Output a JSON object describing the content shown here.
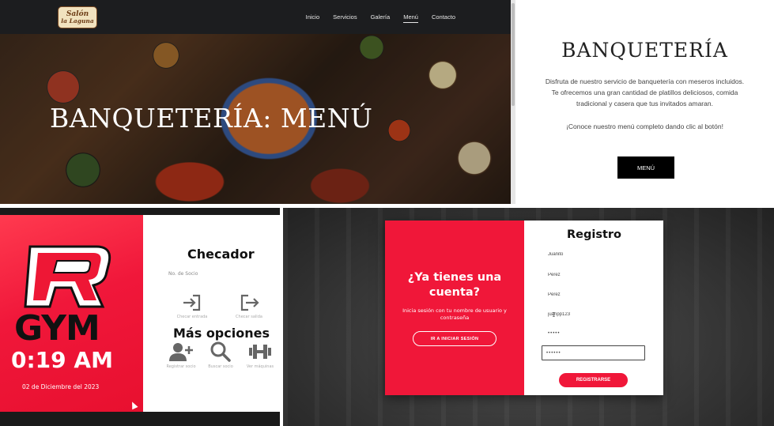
{
  "banquet_site": {
    "logo": {
      "line1": "Salón",
      "line2": "la Laguna"
    },
    "nav": [
      "Inicio",
      "Servicios",
      "Galería",
      "Menú",
      "Contacto"
    ],
    "active_nav": "Menú",
    "hero_title": "BANQUETERÍA: MENÚ",
    "section_title": "BANQUETERÍA",
    "description": "Disfruta de nuestro servicio de banquetería con meseros incluidos. Te ofrecemos una gran cantidad de platillos deliciosos, comida tradicional y casera que tus invitados amaran.",
    "call_to_action": "¡Conoce nuestro menú completo dando clic al botón!",
    "menu_button": "MENÚ"
  },
  "gym_app": {
    "logo_letter": "R",
    "brand": "GYM",
    "time": "0:19 AM",
    "date": "02 de Diciembre del 2023",
    "checador_title": "Checador",
    "socio_label": "No. de Socio",
    "check_in_label": "Checar entrada",
    "check_out_label": "Checar salida",
    "more_title": "Más opciones",
    "add_member_label": "Registrar socio",
    "search_label": "Buscar socio",
    "machines_label": "Ver máquinas"
  },
  "registro": {
    "left_title": "¿Ya tienes una cuenta?",
    "left_text": "Inicia sesión con tu nombre de usuario y contraseña",
    "login_button": "IR A INICIAR SESIÓN",
    "title": "Registro",
    "fields": {
      "nombre": "Juanito",
      "apellido_paterno": "Perez",
      "apellido_materno": "Perez",
      "usuario": "juanpp123",
      "password": "•••••",
      "confirm_password": "••••••"
    },
    "register_button": "REGISTRARSE"
  }
}
